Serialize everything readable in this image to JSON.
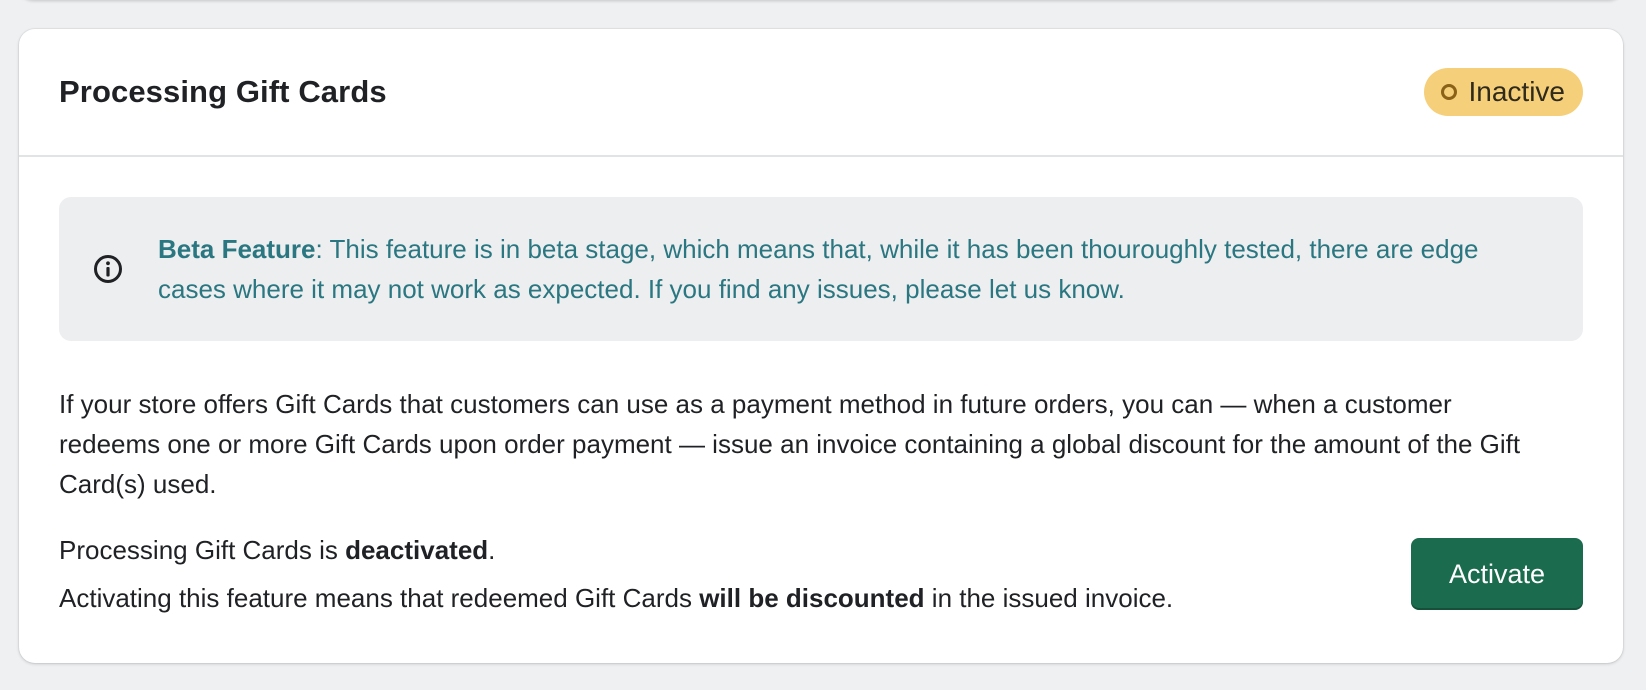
{
  "card": {
    "title": "Processing Gift Cards",
    "status": {
      "label": "Inactive",
      "color": "#f5cf79"
    },
    "banner": {
      "icon": "info-icon",
      "bold_label": "Beta Feature",
      "text": ": This feature is in beta stage, which means that, while it has been thouroughly tested, there are edge cases where it may not work as expected. If you find any issues, please let us know."
    },
    "description": "If your store offers Gift Cards that customers can use as a payment method in future orders, you can — when a customer redeems one or more Gift Cards upon order payment — issue an invoice containing a global discount for the amount of the Gift Card(s) used.",
    "status_line": {
      "prefix": "Processing Gift Cards is ",
      "state": "deactivated",
      "suffix": "."
    },
    "effect_line": {
      "prefix": "Activating this feature means that redeemed Gift Cards ",
      "emphasis": "will be discounted",
      "suffix": " in the issued invoice."
    },
    "activate_button": {
      "label": "Activate",
      "color": "#1b6b4e"
    }
  }
}
